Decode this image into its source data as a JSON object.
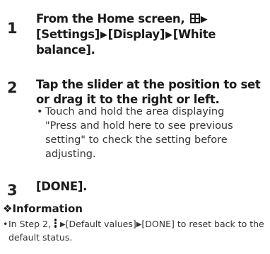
{
  "steps": [
    {
      "number": "1",
      "text_before_icon": "From the Home screen, ",
      "icon": "apps-grid-icon",
      "text_after_icon": "[Settings]",
      "path": [
        "[Display]",
        "[White balance]."
      ]
    },
    {
      "number": "2",
      "text": "Tap the slider at the position to set or drag it to the right or left.",
      "bullet": "Touch and hold the area displaying \"Press and hold here to see previous setting\" to check the setting before adjusting."
    },
    {
      "number": "3",
      "text": "[DONE]."
    }
  ],
  "information": {
    "mark": "❖",
    "title": "Information",
    "bullet_prefix": "In Step 2,",
    "icon": "overflow-menu-icon",
    "bullet_part1": "[Default values]",
    "bullet_part2": "[DONE] to reset back to the default status."
  },
  "glyphs": {
    "arrow": "▶",
    "bullet": "•"
  }
}
